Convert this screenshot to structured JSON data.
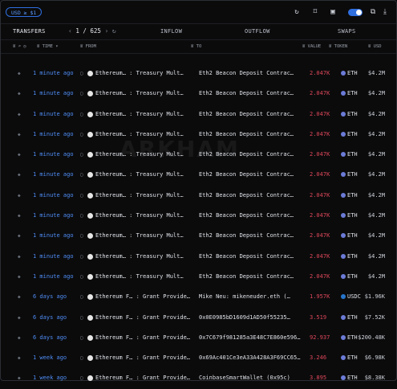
{
  "topbar": {
    "currency": "USD ≥ $1"
  },
  "tabs": {
    "transfers": "TRANSFERS",
    "page_current": "1",
    "page_total": "625",
    "inflow": "INFLOW",
    "outflow": "OUTFLOW",
    "swaps": "SWAPS"
  },
  "columns": {
    "time": "TIME",
    "from": "FROM",
    "to": "TO",
    "value": "VALUE",
    "token": "TOKEN",
    "usd": "USD"
  },
  "rows": [
    {
      "time": "1 minute ago",
      "from": "Ethereum… : Treasury Mult…",
      "to": "Eth2 Beacon Deposit Contrac…",
      "value": "2.047K",
      "token": "ETH",
      "usd": "$4.2M",
      "token_color": "#6b7bd6"
    },
    {
      "time": "1 minute ago",
      "from": "Ethereum… : Treasury Mult…",
      "to": "Eth2 Beacon Deposit Contrac…",
      "value": "2.047K",
      "token": "ETH",
      "usd": "$4.2M",
      "token_color": "#6b7bd6"
    },
    {
      "time": "1 minute ago",
      "from": "Ethereum… : Treasury Mult…",
      "to": "Eth2 Beacon Deposit Contrac…",
      "value": "2.047K",
      "token": "ETH",
      "usd": "$4.2M",
      "token_color": "#6b7bd6"
    },
    {
      "time": "1 minute ago",
      "from": "Ethereum… : Treasury Mult…",
      "to": "Eth2 Beacon Deposit Contrac…",
      "value": "2.047K",
      "token": "ETH",
      "usd": "$4.2M",
      "token_color": "#6b7bd6"
    },
    {
      "time": "1 minute ago",
      "from": "Ethereum… : Treasury Mult…",
      "to": "Eth2 Beacon Deposit Contrac…",
      "value": "2.047K",
      "token": "ETH",
      "usd": "$4.2M",
      "token_color": "#6b7bd6"
    },
    {
      "time": "1 minute ago",
      "from": "Ethereum… : Treasury Mult…",
      "to": "Eth2 Beacon Deposit Contrac…",
      "value": "2.047K",
      "token": "ETH",
      "usd": "$4.2M",
      "token_color": "#6b7bd6"
    },
    {
      "time": "1 minute ago",
      "from": "Ethereum… : Treasury Mult…",
      "to": "Eth2 Beacon Deposit Contrac…",
      "value": "2.047K",
      "token": "ETH",
      "usd": "$4.2M",
      "token_color": "#6b7bd6"
    },
    {
      "time": "1 minute ago",
      "from": "Ethereum… : Treasury Mult…",
      "to": "Eth2 Beacon Deposit Contrac…",
      "value": "2.047K",
      "token": "ETH",
      "usd": "$4.2M",
      "token_color": "#6b7bd6"
    },
    {
      "time": "1 minute ago",
      "from": "Ethereum… : Treasury Mult…",
      "to": "Eth2 Beacon Deposit Contrac…",
      "value": "2.047K",
      "token": "ETH",
      "usd": "$4.2M",
      "token_color": "#6b7bd6"
    },
    {
      "time": "1 minute ago",
      "from": "Ethereum… : Treasury Mult…",
      "to": "Eth2 Beacon Deposit Contrac…",
      "value": "2.047K",
      "token": "ETH",
      "usd": "$4.2M",
      "token_color": "#6b7bd6"
    },
    {
      "time": "1 minute ago",
      "from": "Ethereum… : Treasury Mult…",
      "to": "Eth2 Beacon Deposit Contrac…",
      "value": "2.047K",
      "token": "ETH",
      "usd": "$4.2M",
      "token_color": "#6b7bd6"
    },
    {
      "time": "6 days ago",
      "from": "Ethereum F… : Grant Provide…",
      "to": "Mike Neu: mikeneuder.eth (…",
      "value": "1.957K",
      "token": "USDC",
      "usd": "$1.96K",
      "token_color": "#2775ca"
    },
    {
      "time": "6 days ago",
      "from": "Ethereum F… : Grant Provide…",
      "to": "0x0E0985bD1609d1AD50f55235…",
      "value": "3.519",
      "token": "ETH",
      "usd": "$7.52K",
      "token_color": "#6b7bd6"
    },
    {
      "time": "6 days ago",
      "from": "Ethereum F… : Grant Provide…",
      "to": "0x7C679f981285a3E48C7E860e596…",
      "value": "92.937",
      "token": "ETH",
      "usd": "$200.48K",
      "token_color": "#6b7bd6"
    },
    {
      "time": "1 week ago",
      "from": "Ethereum F… : Grant Provide…",
      "to": "0x69Ac401Ce3eA33A428A3F69CC65…",
      "value": "3.246",
      "token": "ETH",
      "usd": "$6.98K",
      "token_color": "#6b7bd6"
    },
    {
      "time": "1 week ago",
      "from": "Ethereum F… : Grant Provide…",
      "to": "CoinbaseSmartWallet (0x95c)",
      "value": "3.895",
      "token": "ETH",
      "usd": "$8.38K",
      "token_color": "#6b7bd6"
    }
  ],
  "colors": {
    "accent": "#2f6fe0",
    "time": "#4f8df5",
    "value": "#e0485a"
  },
  "watermark": "ARKHAM"
}
